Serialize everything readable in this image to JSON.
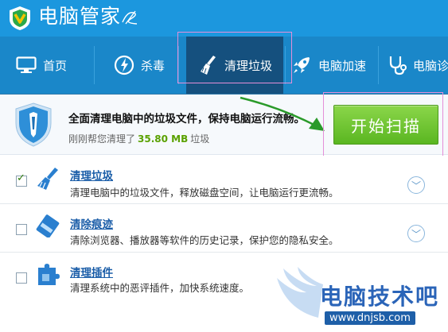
{
  "app": {
    "title": "电脑管家"
  },
  "nav": {
    "items": [
      {
        "label": "首页",
        "icon": "monitor-icon"
      },
      {
        "label": "杀毒",
        "icon": "antivirus-icon"
      },
      {
        "label": "清理垃圾",
        "icon": "broom-icon",
        "active": true
      },
      {
        "label": "电脑加速",
        "icon": "rocket-icon"
      },
      {
        "label": "电脑诊",
        "icon": "stethoscope-icon"
      }
    ]
  },
  "header": {
    "title": "全面清理电脑中的垃圾文件，保持电脑运行流畅。",
    "sub_prefix": "刚刚帮您清理了",
    "sub_amount": "35.80 MB",
    "sub_suffix": "垃圾",
    "start_button": "开始扫描"
  },
  "list": {
    "items": [
      {
        "title": "清理垃圾",
        "desc": "清理电脑中的垃圾文件，释放磁盘空间，让电脑运行更流畅。",
        "checked": true,
        "expandable": true,
        "icon": "broom-icon"
      },
      {
        "title": "清除痕迹",
        "desc": "清除浏览器、播放器等软件的历史记录，保护您的隐私安全。",
        "checked": false,
        "expandable": true,
        "icon": "eraser-icon"
      },
      {
        "title": "清理插件",
        "desc": "清理系统中的恶评插件，加快系统速度。",
        "checked": false,
        "expandable": false,
        "icon": "puzzle-icon"
      }
    ]
  },
  "watermark": {
    "text": "电脑技术吧",
    "url": "www.dnjsb.com"
  },
  "colors": {
    "titlebar": "#1c97de",
    "navbar": "#1a87c9",
    "nav_active": "#15507e",
    "start_button": "#5ab621",
    "highlight": "#e48fd9",
    "arrow": "#2a9a2a"
  }
}
